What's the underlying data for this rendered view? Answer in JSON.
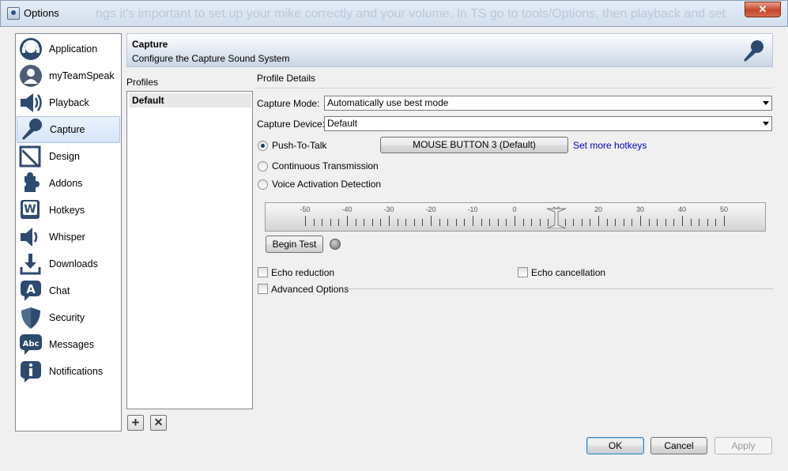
{
  "window": {
    "title": "Options",
    "close_label": "✕",
    "background_text": "ngs it's important to set up your mike correctly and your volume. In TS go to tools/Options, then playback and set"
  },
  "nav": {
    "items": [
      {
        "label": "Application",
        "icon": "headset-icon"
      },
      {
        "label": "myTeamSpeak",
        "icon": "user-icon"
      },
      {
        "label": "Playback",
        "icon": "speaker-icon"
      },
      {
        "label": "Capture",
        "icon": "microphone-icon",
        "active": true
      },
      {
        "label": "Design",
        "icon": "design-icon"
      },
      {
        "label": "Addons",
        "icon": "puzzle-icon"
      },
      {
        "label": "Hotkeys",
        "icon": "keyboard-key-icon"
      },
      {
        "label": "Whisper",
        "icon": "whisper-icon"
      },
      {
        "label": "Downloads",
        "icon": "download-icon"
      },
      {
        "label": "Chat",
        "icon": "chat-icon"
      },
      {
        "label": "Security",
        "icon": "shield-icon"
      },
      {
        "label": "Messages",
        "icon": "messages-icon"
      },
      {
        "label": "Notifications",
        "icon": "info-icon"
      }
    ]
  },
  "header": {
    "title": "Capture",
    "subtitle": "Configure the Capture Sound System"
  },
  "profiles": {
    "label": "Profiles",
    "items": [
      "Default"
    ],
    "add_label": "+",
    "remove_label": "✕"
  },
  "details": {
    "label": "Profile Details",
    "capture_mode_label": "Capture Mode:",
    "capture_mode_value": "Automatically use best mode",
    "capture_device_label": "Capture Device:",
    "capture_device_value": "Default",
    "radio_options": [
      {
        "label": "Push-To-Talk",
        "checked": true
      },
      {
        "label": "Continuous Transmission",
        "checked": false
      },
      {
        "label": "Voice Activation Detection",
        "checked": false
      }
    ],
    "hotkey_button": "MOUSE BUTTON 3 (Default)",
    "more_hotkeys": "Set more hotkeys",
    "slider": {
      "tick_labels": [
        "-50",
        "-40",
        "-30",
        "-20",
        "-10",
        "0",
        "10",
        "20",
        "30",
        "40",
        "50"
      ],
      "value": 10
    },
    "begin_test": "Begin Test",
    "echo_reduction": "Echo reduction",
    "echo_cancellation": "Echo cancellation",
    "advanced_options": "Advanced Options"
  },
  "footer": {
    "ok": "OK",
    "cancel": "Cancel",
    "apply": "Apply"
  }
}
